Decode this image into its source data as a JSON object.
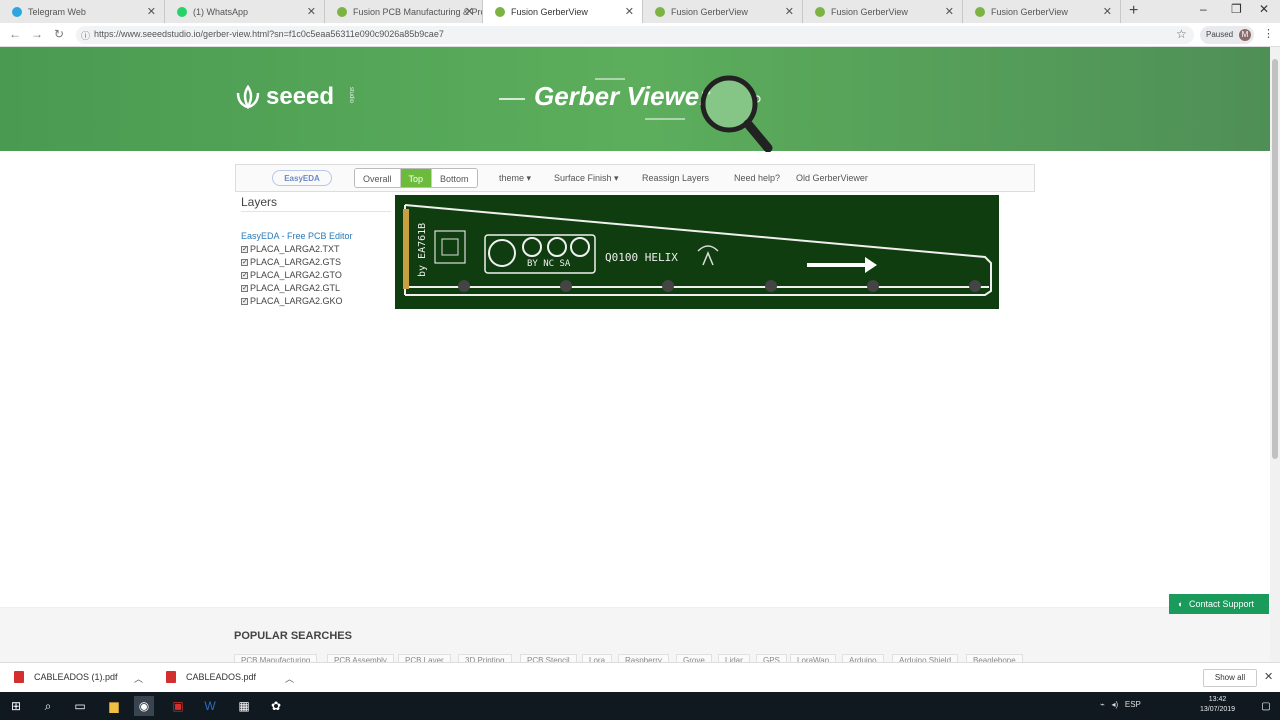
{
  "tabs": [
    {
      "title": "Telegram Web",
      "color": "#2ca5e0"
    },
    {
      "title": "(1) WhatsApp",
      "color": "#25d366"
    },
    {
      "title": "Fusion PCB Manufacturing & Pro",
      "color": "#7cb342"
    },
    {
      "title": "Fusion GerberView",
      "color": "#7cb342"
    },
    {
      "title": "Fusion GerberView",
      "color": "#7cb342"
    },
    {
      "title": "Fusion GerberView",
      "color": "#7cb342"
    },
    {
      "title": "Fusion GerberView",
      "color": "#7cb342"
    }
  ],
  "active_tab": 3,
  "address": {
    "url": "https://www.seeedstudio.io/gerber-view.html?sn=f1c0c5eaa56311e090c9026a85b9cae7"
  },
  "profile": {
    "label": "Paused",
    "initial": "M"
  },
  "hero": {
    "logo": "seeed",
    "logo_sub": "studio",
    "title": "Gerber Viewer"
  },
  "viewer_nav": {
    "easyeda_label": "EasyEDA",
    "views": [
      "Overall",
      "Top",
      "Bottom"
    ],
    "selected_view": "Top",
    "theme": "theme ▾",
    "surface": "Surface Finish ▾",
    "reassign": "Reassign Layers",
    "help": "Need help?",
    "old": "Old GerberViewer"
  },
  "layers": {
    "title": "Layers",
    "editor_link": "EasyEDA - Free PCB Editor",
    "items": [
      "PLACA_LARGA2.TXT",
      "PLACA_LARGA2.GTS",
      "PLACA_LARGA2.GTO",
      "PLACA_LARGA2.GTL",
      "PLACA_LARGA2.GKO"
    ]
  },
  "pcb": {
    "silk_code": "by EA761B",
    "cc_text": "BY NC SA",
    "model": "Q0100 HELIX",
    "board_color": "#0f3d0f"
  },
  "popular": {
    "title": "POPULAR SEARCHES",
    "chips": [
      "PCB Manufacturing",
      "PCB Assembly",
      "PCB Layer",
      "3D Printing",
      "PCB Stencil",
      "Lora",
      "Raspberry",
      "Grove",
      "Lidar",
      "GPS",
      "LoraWan",
      "Arduino",
      "Arduino Shield",
      "Beaglebone"
    ]
  },
  "contact_support": "Contact Support",
  "downloads": [
    {
      "name": "CABLEADOS (1).pdf"
    },
    {
      "name": "CABLEADOS.pdf"
    }
  ],
  "show_all": "Show all",
  "taskbar": {
    "lang": "ESP",
    "time": "13:42",
    "date": "13/07/2019"
  }
}
